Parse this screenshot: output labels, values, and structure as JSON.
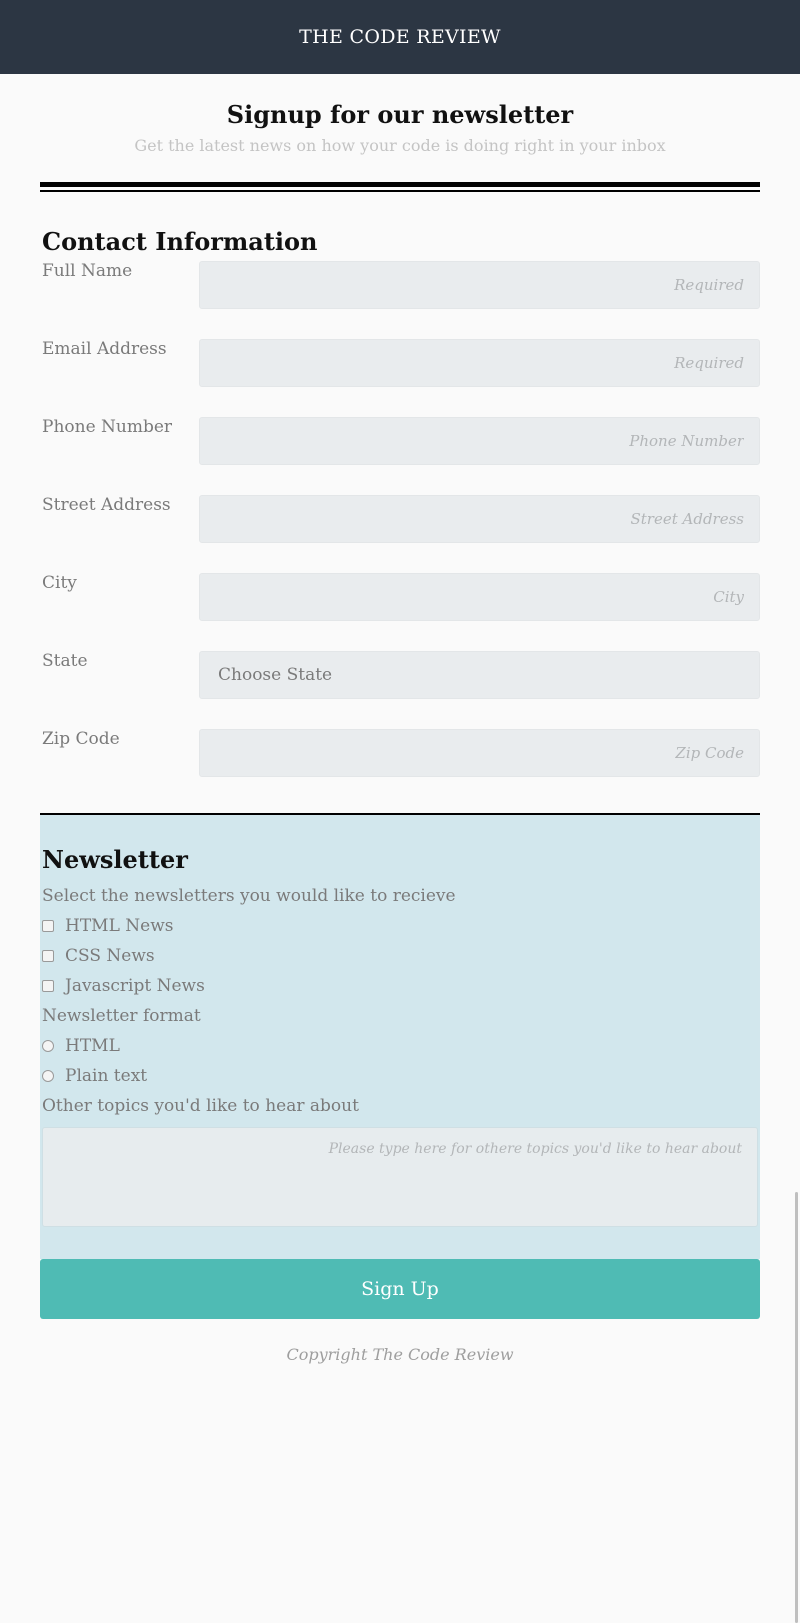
{
  "header": {
    "title": "THE CODE REVIEW"
  },
  "intro": {
    "title": "Signup for our newsletter",
    "subtitle": "Get the latest news on how your code is doing right in your inbox"
  },
  "contact": {
    "title": "Contact Information",
    "fields": [
      {
        "label": "Full Name",
        "placeholder": "Required"
      },
      {
        "label": "Email Address",
        "placeholder": "Required"
      },
      {
        "label": "Phone Number",
        "placeholder": "Phone Number"
      },
      {
        "label": "Street Address",
        "placeholder": "Street Address"
      },
      {
        "label": "City",
        "placeholder": "City"
      },
      {
        "label": "State",
        "value": "Choose State"
      },
      {
        "label": "Zip Code",
        "placeholder": "Zip Code"
      }
    ]
  },
  "newsletter": {
    "title": "Newsletter",
    "select_prompt": "Select the newsletters you would like to recieve",
    "options": [
      "HTML News",
      "CSS News",
      "Javascript News"
    ],
    "format_label": "Newsletter format",
    "formats": [
      "HTML",
      "Plain text"
    ],
    "topics_label": "Other topics you'd like to hear about",
    "topics_placeholder": "Please type here for othere topics you'd like to hear about"
  },
  "signup_button": "Sign Up",
  "footer": "Copyright The Code Review",
  "colors": {
    "header_bg": "#2c3643",
    "newsletter_bg": "#d2e7ed",
    "button_bg": "#4fbbb4"
  }
}
